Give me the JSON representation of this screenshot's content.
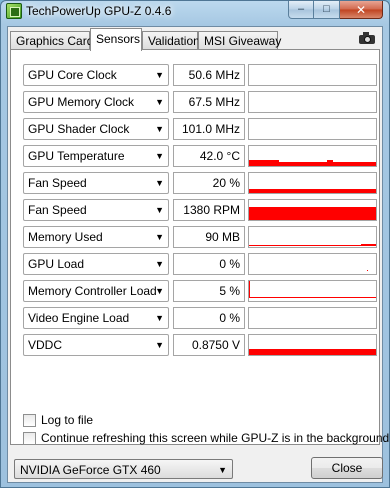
{
  "window": {
    "title": "TechPowerUp GPU-Z 0.4.6",
    "min_symbol": "–",
    "max_symbol": "□",
    "close_symbol": "✕"
  },
  "tabs": [
    {
      "label": "Graphics Card",
      "active": false
    },
    {
      "label": "Sensors",
      "active": true
    },
    {
      "label": "Validation",
      "active": false
    },
    {
      "label": "MSI Giveaway",
      "active": false
    }
  ],
  "dropdown_arrow": "▼",
  "graph_color": "#ff0000",
  "sensors": [
    {
      "name": "GPU Core Clock",
      "value": "50.6 MHz",
      "level": 0,
      "shape": "none"
    },
    {
      "name": "GPU Memory Clock",
      "value": "67.5 MHz",
      "level": 0,
      "shape": "none"
    },
    {
      "name": "GPU Shader Clock",
      "value": "101.0 MHz",
      "level": 0,
      "shape": "none"
    },
    {
      "name": "GPU Temperature",
      "value": "42.0 °C",
      "level": 0.2,
      "shape": "temp"
    },
    {
      "name": "Fan Speed",
      "value": "20 %",
      "level": 0.2,
      "shape": "flat"
    },
    {
      "name": "Fan Speed",
      "value": "1380 RPM",
      "level": 0.65,
      "shape": "flat"
    },
    {
      "name": "Memory Used",
      "value": "90 MB",
      "level": 0.05,
      "shape": "memory"
    },
    {
      "name": "GPU Load",
      "value": "0 %",
      "level": 0,
      "shape": "dot"
    },
    {
      "name": "Memory Controller Load",
      "value": "5 %",
      "level": 0.05,
      "shape": "line"
    },
    {
      "name": "Video Engine Load",
      "value": "0 %",
      "level": 0,
      "shape": "none"
    },
    {
      "name": "VDDC",
      "value": "0.8750 V",
      "level": 0.3,
      "shape": "flat"
    }
  ],
  "options": {
    "log_to_file": "Log to file",
    "continue_refreshing": "Continue refreshing this screen while GPU-Z is in the background"
  },
  "device_select": {
    "value": "NVIDIA GeForce GTX 460"
  },
  "close_button": "Close"
}
